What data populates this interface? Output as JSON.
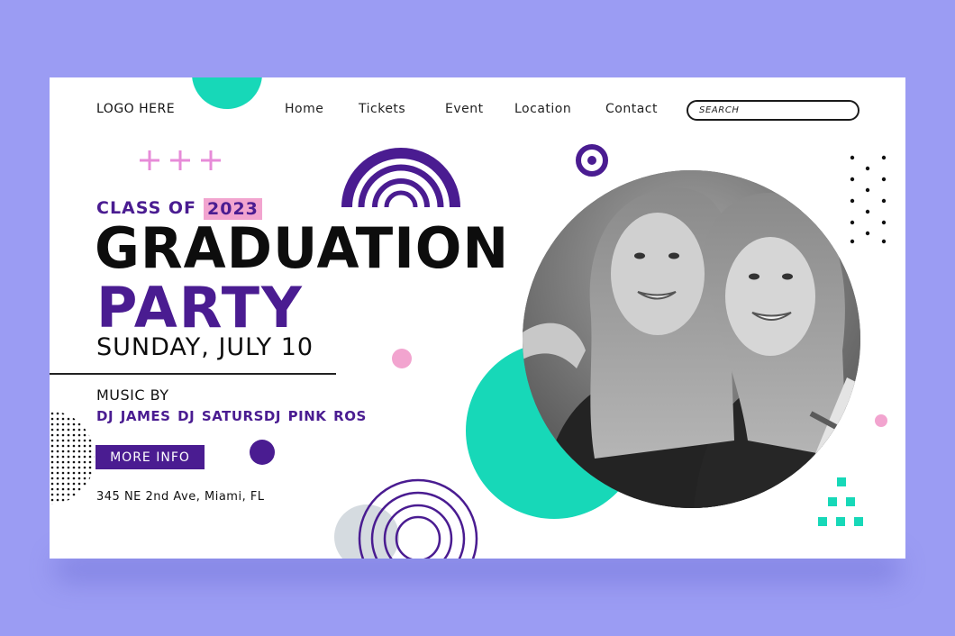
{
  "header": {
    "logo": "LOGO HERE",
    "nav": [
      "Home",
      "Tickets",
      "Event",
      "Location",
      "Contact"
    ],
    "search_placeholder": "SEARCH"
  },
  "hero": {
    "class_of": "CLASS OF",
    "year": "2023",
    "title_line1": "GRADUATION",
    "title_line2": "PARTY",
    "date": "SUNDAY, JULY 10",
    "music_by": "MUSIC BY",
    "djs": "DJ JAMES  DJ SATURSDJ PINK ROS",
    "button_label": "MORE INFO",
    "address": "345 NE 2nd Ave, Miami, FL"
  },
  "colors": {
    "background": "#9b9cf3",
    "purple": "#4a1c91",
    "teal": "#17d8b8",
    "pink": "#f2a4cf",
    "light_gray": "#d5dbe0"
  },
  "icons": [
    "search-icon",
    "plus-icon"
  ]
}
